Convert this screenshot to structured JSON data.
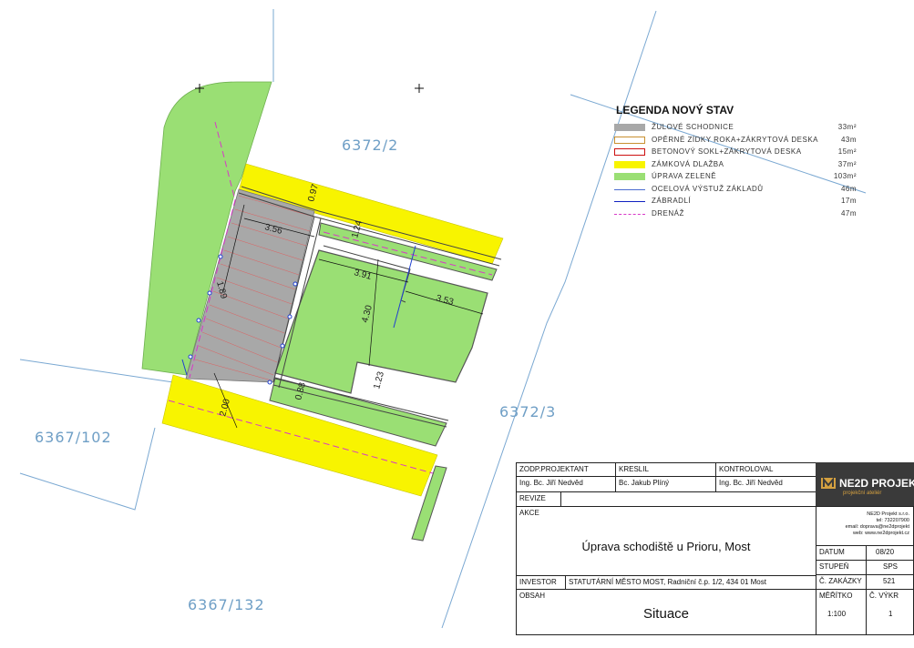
{
  "parcels": [
    "6372/2",
    "6372/3",
    "6367/102",
    "6367/132"
  ],
  "dimensions": [
    "3.56",
    "1.89",
    "3.91",
    "1.24",
    "3.53",
    "4.30",
    "0.97",
    "0.88",
    "1.23",
    "2.00"
  ],
  "legend": {
    "title": "LEGENDA NOVÝ STAV",
    "items": [
      {
        "label": "ŽULOVÉ SCHODNICE",
        "qty": "33m²",
        "color": "#a8a8a8"
      },
      {
        "label": "OPĚRNÉ ZÍDKY ROKA+ZÁKRYTOVÁ DESKA",
        "qty": "43m",
        "color": "#c89030"
      },
      {
        "label": "BETONOVÝ SOKL+ZÁKRYTOVÁ DESKA",
        "qty": "15m²",
        "color": "#cc1010"
      },
      {
        "label": "ZÁMKOVÁ DLAŽBA",
        "qty": "37m²",
        "color": "#f8f400"
      },
      {
        "label": "ÚPRAVA ZELENĚ",
        "qty": "103m²",
        "color": "#9adf74"
      },
      {
        "label": "OCELOVÁ VÝSTUŽ ZÁKLADŮ",
        "qty": "46m",
        "color": "#4a6cd0"
      },
      {
        "label": "ZÁBRADLÍ",
        "qty": "17m",
        "color": "#1020c0"
      },
      {
        "label": "DRENÁŽ",
        "qty": "47m",
        "color": "#d838c8"
      }
    ]
  },
  "titleblock": {
    "zodp_label": "ZODP.PROJEKTANT",
    "zodp_name": "Ing. Bc. Jiří Nedvěd",
    "kreslil_label": "KRESLIL",
    "kreslil_name": "Bc. Jakub Plíný",
    "kontroloval_label": "KONTROLOVAL",
    "kontroloval_name": "Ing. Bc. Jiří Nedvěd",
    "revize_label": "REVIZE",
    "akce_label": "AKCE",
    "akce_value": "Úprava schodiště u Prioru, Most",
    "investor_label": "INVESTOR",
    "investor_value": "STATUTÁRNÍ MĚSTO MOST, Radniční č.p. 1/2, 434 01 Most",
    "obsah_label": "OBSAH",
    "obsah_value": "Situace",
    "logo_text": "NE2D PROJEK",
    "logo_sub": "projekční ateliér",
    "company_name": "NE2D Projekt s.r.o.",
    "company_tel": "tel: 732207900",
    "company_email": "email: dopravа@ne2dprojekt",
    "company_web": "web: www.ne2dprojekt.cz",
    "datum_label": "DATUM",
    "datum_value": "08/20",
    "stupen_label": "STUPEŇ",
    "stupen_value": "SPS",
    "zakazky_label": "Č. ZAKÁZKY",
    "zakazky_value": "521",
    "meritko_label": "MĚŘÍTKO",
    "meritko_value": "1:100",
    "vykresu_label": "Č. VÝKR",
    "vykresu_value": "1"
  }
}
